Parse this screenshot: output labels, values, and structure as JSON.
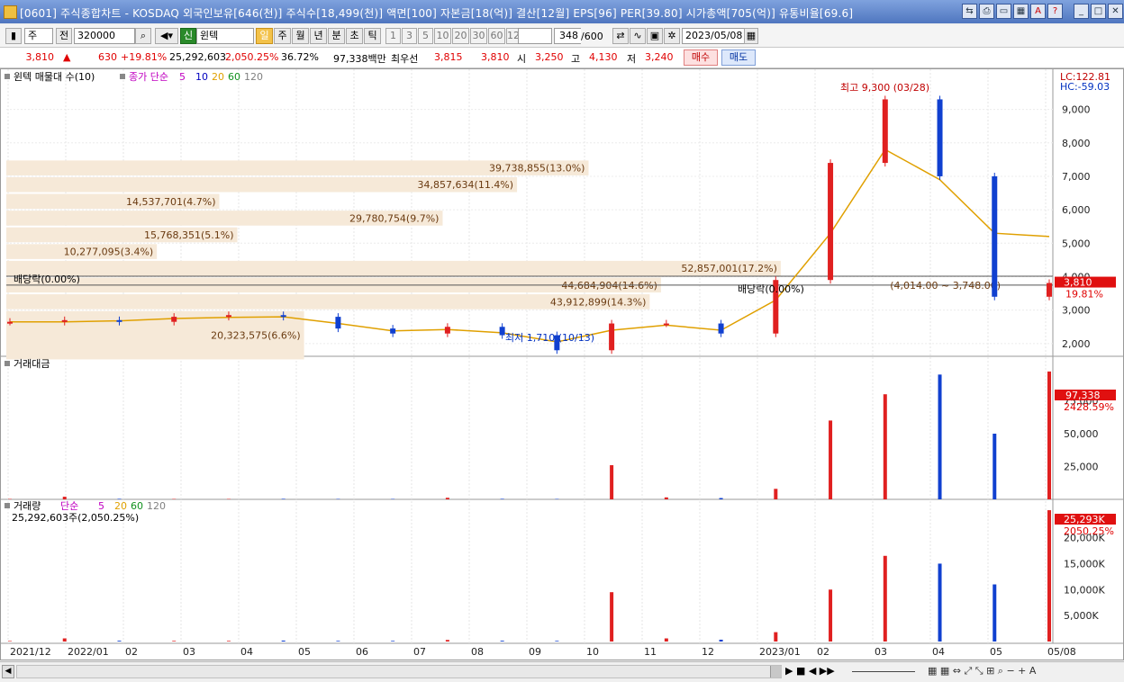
{
  "window": {
    "title": "[0601] 주식종합차트 - KOSDAQ 외국인보유[646(천)] 주식수[18,499(천)] 액면[100] 자본금[18(억)] 결산[12월] EPS[96] PER[39.80] 시가총액[705(억)] 유통비율[69.6]"
  },
  "toolbar": {
    "unit": "주",
    "period_prefix": "전",
    "code": "320000",
    "stock_badge": "신",
    "stock_name": "윈텍",
    "periods": [
      "일",
      "주",
      "월",
      "년",
      "분",
      "초",
      "틱"
    ],
    "selected_period": "일",
    "intervals": [
      "1",
      "3",
      "5",
      "10",
      "20",
      "30",
      "60",
      "120"
    ],
    "count_value": "348",
    "count_total": "/600",
    "date": "2023/05/08"
  },
  "quote": {
    "price": "3,810",
    "arrow": "▲",
    "change": "630",
    "change_pct": "+19.81%",
    "volume": "25,292,603",
    "volume_pct": "2,050.25%",
    "turnover": "36.72%",
    "amount": "97,338백만",
    "best_ask_label": "최우선",
    "best_ask": "3,815",
    "best_bid": "3,810",
    "open_label": "시",
    "open": "3,250",
    "high_label": "고",
    "high": "4,130",
    "low_label": "저",
    "low": "3,240",
    "buy_label": "매수",
    "sell_label": "매도"
  },
  "colors": {
    "up": "#e02020",
    "down": "#1040d0",
    "ma5": "#c000c0",
    "ma10": "#0000c0",
    "ma20": "#e0a000",
    "ma60": "#10901c",
    "ma120": "#808080",
    "profile": "#f6e9d8"
  },
  "price_panel": {
    "legend_profile": "윈텍 매물대 수(10)",
    "legend_ma": "종가 단순",
    "ma_periods": [
      "5",
      "10",
      "20",
      "60",
      "120"
    ],
    "lc": "LC:122.81",
    "hc": "HC:-59.03",
    "high_label": "최고 9,300 (03/28)",
    "low_label": "최저 1,710 (10/13)",
    "dividend_label": "배당락(0.00%)",
    "dividend_label2": "배당락(0.00%)",
    "last_price": "3,810",
    "last_pct": "19.81%",
    "profile_labels": [
      "20,323,575(6.6%)",
      "43,912,899(14.3%)",
      "44,684,904(14.6%)",
      "52,857,001(17.2%)",
      "10,277,095(3.4%)",
      "15,768,351(5.1%)",
      "29,780,754(9.7%)",
      "14,537,701(4.7%)",
      "34,857,634(11.4%)",
      "39,738,855(13.0%)"
    ],
    "range_label": "(4,014.00 ~ 3,748.00)",
    "yticks": [
      "2,000",
      "3,000",
      "4,000",
      "5,000",
      "6,000",
      "7,000",
      "8,000",
      "9,000"
    ]
  },
  "amount_panel": {
    "title": "거래대금",
    "last": "97,338",
    "last_pct": "2428.59%",
    "yticks": [
      "25,000",
      "50,000",
      "75,000"
    ]
  },
  "volume_panel": {
    "title": "거래량",
    "legend_ma": "단순",
    "ma_periods": [
      "5",
      "20",
      "60",
      "120"
    ],
    "info": "25,292,603주(2,050.25%)",
    "last": "25,293K",
    "last_pct": "2050.25%",
    "yticks": [
      "5,000K",
      "10,000K",
      "15,000K",
      "20,000K"
    ]
  },
  "xaxis": {
    "labels": [
      "2021/12",
      "2022/01",
      "02",
      "03",
      "04",
      "05",
      "06",
      "07",
      "08",
      "09",
      "10",
      "11",
      "12",
      "2023/01",
      "02",
      "03",
      "04",
      "05",
      "05/08"
    ]
  },
  "chart_data": {
    "type": "candlestick",
    "x": [
      "2021/12",
      "2022/01",
      "2022/02",
      "2022/03",
      "2022/04",
      "2022/05",
      "2022/06",
      "2022/07",
      "2022/08",
      "2022/09",
      "2022/10",
      "2022/11",
      "2022/12",
      "2023/01",
      "2023/02",
      "2023/03",
      "2023/03/28",
      "2023/04",
      "2023/05",
      "2023/05/08"
    ],
    "close": [
      2650,
      2700,
      2650,
      2800,
      2850,
      2800,
      2450,
      2300,
      2500,
      2250,
      1800,
      2600,
      2600,
      2300,
      3900,
      7400,
      9300,
      7000,
      3400,
      3810
    ],
    "ma20": [
      2650,
      2650,
      2680,
      2750,
      2780,
      2800,
      2600,
      2380,
      2420,
      2320,
      2050,
      2400,
      2550,
      2400,
      3300,
      5300,
      7800,
      6900,
      5300,
      5200
    ],
    "volume_k": [
      100,
      600,
      150,
      120,
      120,
      180,
      120,
      120,
      300,
      150,
      120,
      9500,
      600,
      350,
      1800,
      10000,
      16500,
      15000,
      11000,
      25293
    ],
    "amount_m": [
      300,
      2000,
      400,
      300,
      300,
      400,
      300,
      300,
      1200,
      400,
      300,
      26000,
      1500,
      1000,
      8000,
      60000,
      80000,
      95000,
      50000,
      97338
    ],
    "ylim_price": [
      1700,
      9500
    ],
    "ylim_amount": [
      0,
      100000
    ],
    "ylim_volume_k": [
      0,
      25300
    ],
    "profile": [
      {
        "low": 1500,
        "high": 3000,
        "volume": 20323575,
        "pct": 6.6
      },
      {
        "low": 3000,
        "high": 3500,
        "volume": 43912899,
        "pct": 14.3
      },
      {
        "low": 3500,
        "high": 4000,
        "volume": 44684904,
        "pct": 14.6
      },
      {
        "low": 4000,
        "high": 4500,
        "volume": 52857001,
        "pct": 17.2
      },
      {
        "low": 4500,
        "high": 5000,
        "volume": 10277095,
        "pct": 3.4
      },
      {
        "low": 5000,
        "high": 5500,
        "volume": 15768351,
        "pct": 5.1
      },
      {
        "low": 5500,
        "high": 6000,
        "volume": 29780754,
        "pct": 9.7
      },
      {
        "low": 6000,
        "high": 6500,
        "volume": 14537701,
        "pct": 4.7
      },
      {
        "low": 6500,
        "high": 7000,
        "volume": 34857634,
        "pct": 11.4
      },
      {
        "low": 7000,
        "high": 7500,
        "volume": 39738855,
        "pct": 13.0
      }
    ]
  }
}
